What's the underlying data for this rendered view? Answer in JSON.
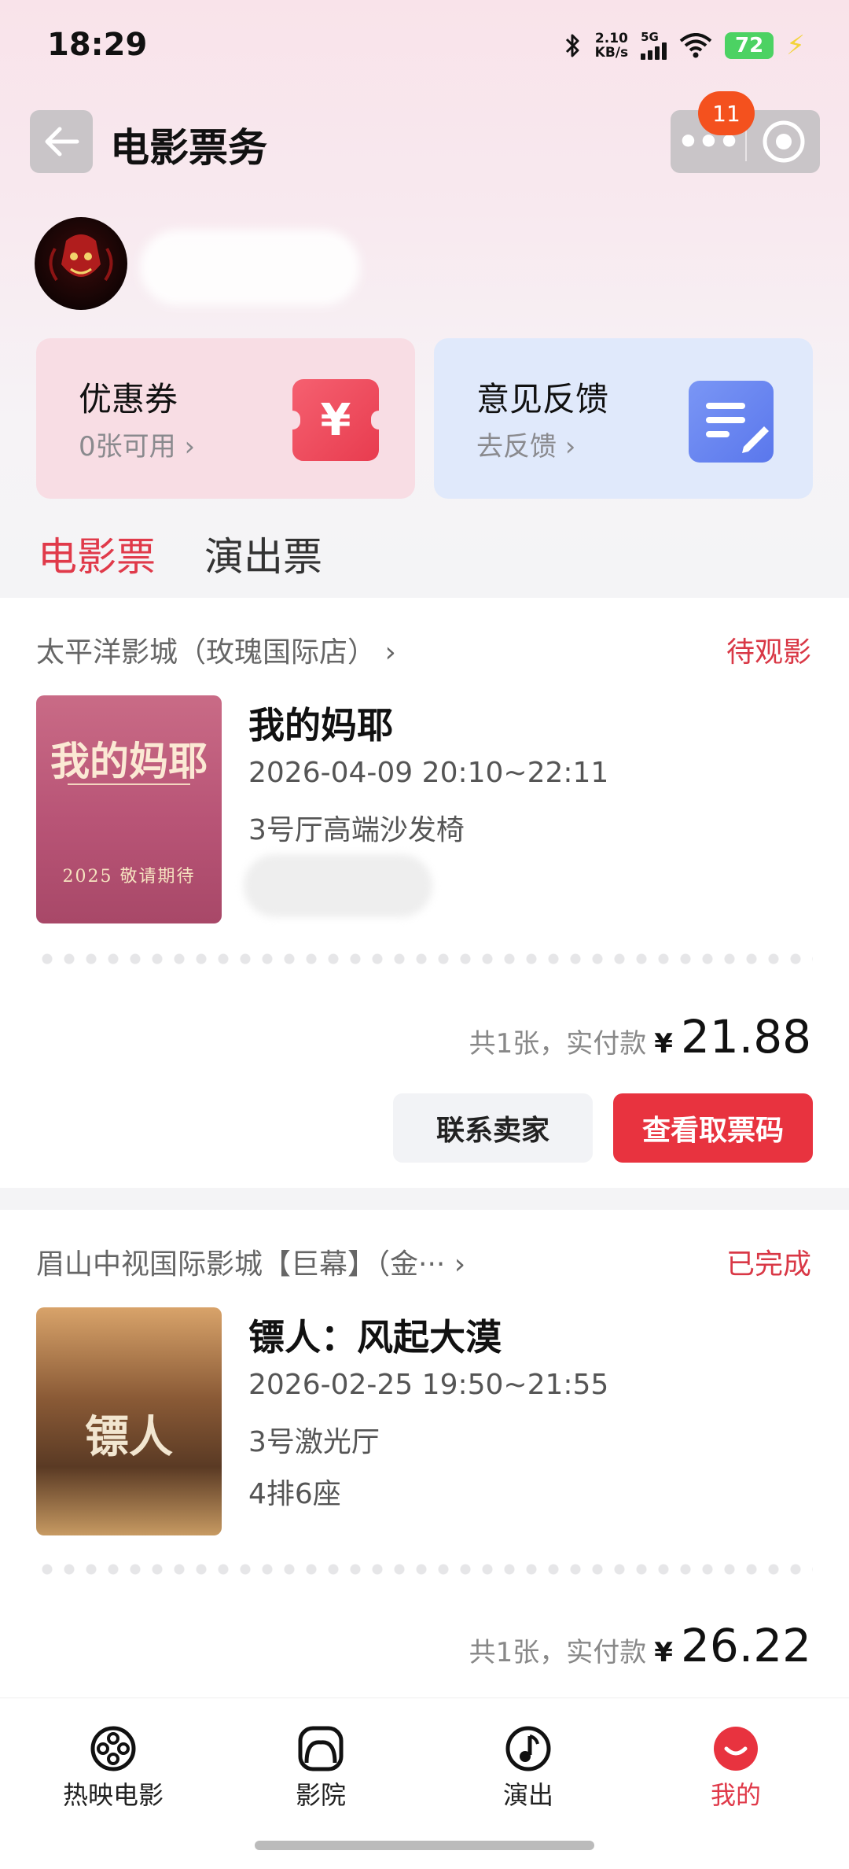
{
  "status_bar": {
    "time": "18:29",
    "net_speed_value": "2.10",
    "net_speed_unit": "KB/s",
    "network": "5G",
    "battery": "72"
  },
  "header": {
    "title": "电影票务",
    "notification_count": "11"
  },
  "cards": {
    "coupon": {
      "title": "优惠券",
      "subtitle": "0张可用 ›",
      "icon_glyph": "¥"
    },
    "feedback": {
      "title": "意见反馈",
      "subtitle": "去反馈 ›"
    }
  },
  "tabs": {
    "movie": "电影票",
    "show": "演出票"
  },
  "orders": [
    {
      "cinema": "太平洋影城（玫瑰国际店） ›",
      "status": "待观影",
      "poster_title": "我的妈耶",
      "poster_footer": "2025 敬请期待",
      "title": "我的妈耶",
      "time": "2026-04-09 20:10~22:11",
      "hall": "3号厅高端沙发椅",
      "total_label": "共1张，实付款",
      "currency": "¥",
      "amount": "21.88",
      "btn_contact": "联系卖家",
      "btn_ticket": "查看取票码"
    },
    {
      "cinema": "眉山中视国际影城【巨幕】（金··· ›",
      "status": "已完成",
      "poster_title": "镖人",
      "title": "镖人：风起大漠",
      "time": "2026-02-25 19:50~21:55",
      "hall": "3号激光厅",
      "seat": "4排6座",
      "total_label": "共1张，实付款",
      "currency": "¥",
      "amount": "26.22"
    }
  ],
  "bottom_nav": [
    {
      "label": "热映电影",
      "icon": "film-reel-icon"
    },
    {
      "label": "影院",
      "icon": "cinema-icon"
    },
    {
      "label": "演出",
      "icon": "music-note-icon"
    },
    {
      "label": "我的",
      "icon": "profile-icon",
      "active": true
    }
  ],
  "colors": {
    "accent": "#e8333f",
    "status_red": "#d93846"
  }
}
